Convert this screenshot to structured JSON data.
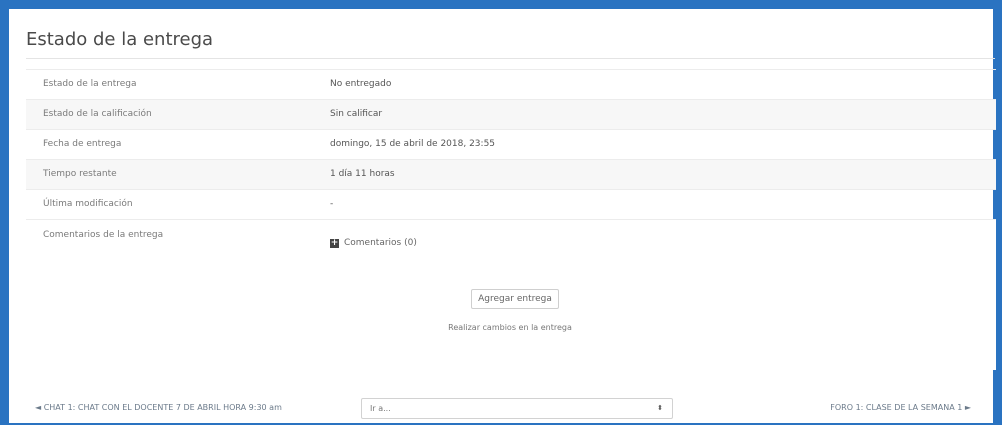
{
  "section_title": "Estado de la entrega",
  "rows": [
    {
      "label": "Estado de la entrega",
      "value": "No entregado"
    },
    {
      "label": "Estado de la calificación",
      "value": "Sin calificar"
    },
    {
      "label": "Fecha de entrega",
      "value": "domingo, 15 de abril de 2018, 23:55"
    },
    {
      "label": "Tiempo restante",
      "value": "1 día 11 horas"
    },
    {
      "label": "Última modificación",
      "value": "-"
    },
    {
      "label": "Comentarios de la entrega",
      "value": ""
    }
  ],
  "comments_link": "Comentarios (0)",
  "add_submission_button": "Agregar entrega",
  "add_submission_hint": "Realizar cambios en la entrega",
  "nav": {
    "prev": "◄ CHAT 1: CHAT CON EL DOCENTE 7 DE ABRIL HORA 9:30 am",
    "next": "FORO 1: CLASE DE LA SEMANA 1 ►",
    "jump_placeholder": "Ir a...",
    "jump_caret": "⬍"
  }
}
